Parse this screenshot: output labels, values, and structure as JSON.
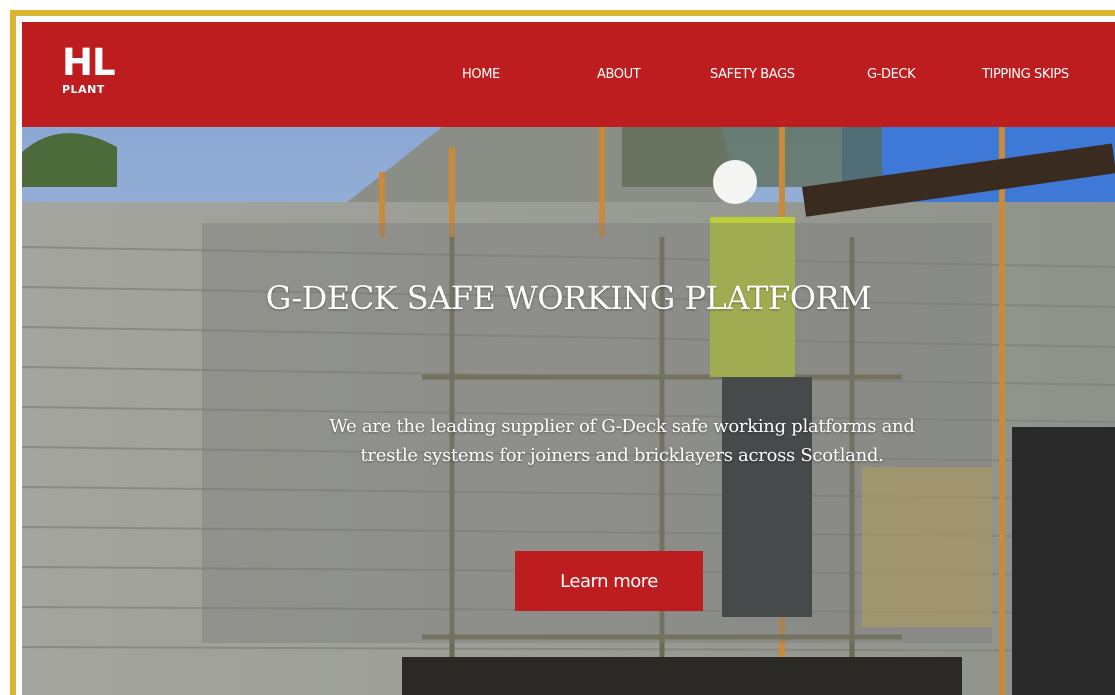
{
  "brand": {
    "logo_main": "HL",
    "logo_sub": "PLANT",
    "color": "#bd1d1f"
  },
  "nav": {
    "items": [
      {
        "label": "HOME"
      },
      {
        "label": "ABOUT"
      },
      {
        "label": "SAFETY BAGS"
      },
      {
        "label": "G-DECK"
      },
      {
        "label": "TIPPING SKIPS"
      }
    ]
  },
  "hero": {
    "title": "G-DECK SAFE WORKING PLATFORM",
    "text": "We are the leading supplier of G-Deck safe working platforms and trestle systems for joiners and bricklayers across Scotland.",
    "cta_label": "Learn more"
  }
}
